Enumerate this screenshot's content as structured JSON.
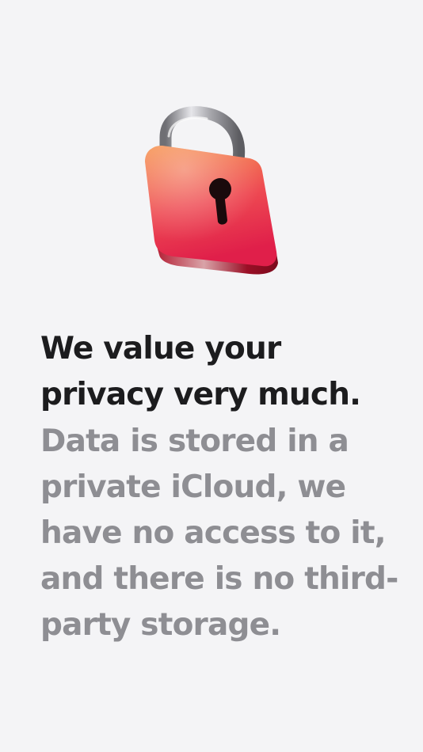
{
  "illustration": {
    "icon": "padlock-icon",
    "colors": {
      "body_top": "#f58a46",
      "body_bottom": "#e8284f",
      "shackle": "#c9c9cc",
      "keyhole": "#1a0a0c"
    }
  },
  "headline": {
    "lines": [
      "We value your",
      "privacy very much."
    ]
  },
  "body": {
    "lines": [
      "Data is stored in a",
      "private iCloud, we",
      "have no access to it,",
      "and there is no third-",
      "party storage."
    ]
  },
  "colors": {
    "background": "#f4f4f6",
    "headline": "#1c1c1e",
    "body": "#8e8e93"
  }
}
